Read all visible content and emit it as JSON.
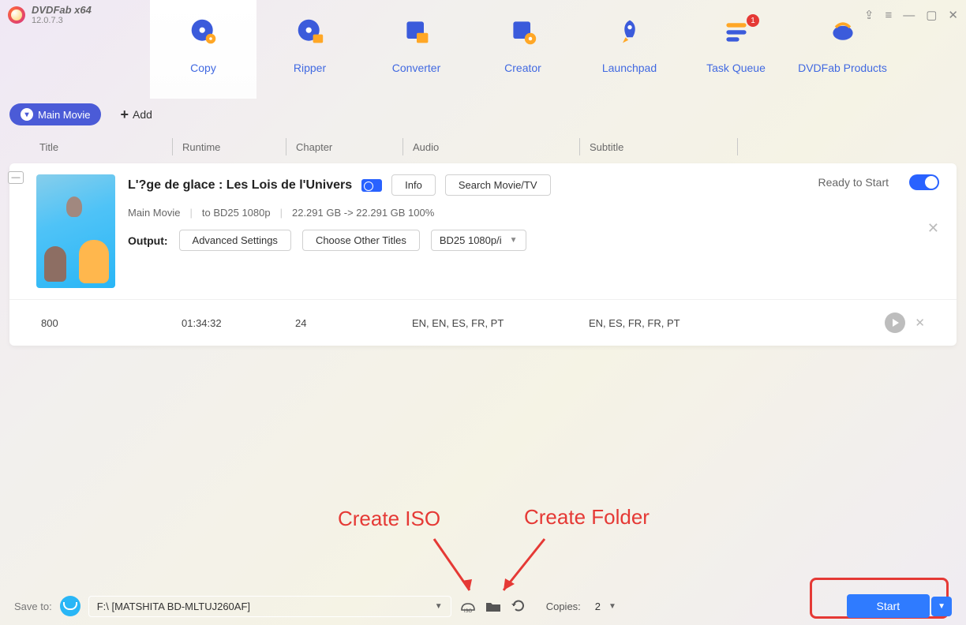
{
  "app": {
    "name": "DVDFab x64",
    "version": "12.0.7.3"
  },
  "tabs": [
    {
      "label": "Copy",
      "active": true
    },
    {
      "label": "Ripper"
    },
    {
      "label": "Converter"
    },
    {
      "label": "Creator"
    },
    {
      "label": "Launchpad"
    },
    {
      "label": "Task Queue",
      "badge": "1"
    },
    {
      "label": "DVDFab Products"
    }
  ],
  "mode": {
    "pill": "Main Movie",
    "add": "Add"
  },
  "columns": {
    "title": "Title",
    "runtime": "Runtime",
    "chapter": "Chapter",
    "audio": "Audio",
    "subtitle": "Subtitle"
  },
  "movie": {
    "title": "L'?ge de glace : Les Lois de l'Univers",
    "info_btn": "Info",
    "search_btn": "Search Movie/TV",
    "status": "Ready to Start",
    "meta": {
      "mode": "Main Movie",
      "target": "to BD25 1080p",
      "size": "22.291 GB -> 22.291 GB 100%"
    },
    "output_label": "Output:",
    "adv": "Advanced Settings",
    "other": "Choose Other Titles",
    "profile": "BD25 1080p/i"
  },
  "row": {
    "title": "800",
    "runtime": "01:34:32",
    "chapter": "24",
    "audio": "EN, EN, ES, FR, PT",
    "subtitle": "EN, ES, FR, FR, PT"
  },
  "anno": {
    "iso": "Create ISO",
    "folder": "Create Folder"
  },
  "bottom": {
    "saveto": "Save to:",
    "path": "F:\\ [MATSHITA BD-MLTUJ260AF]",
    "copies": "Copies:",
    "copies_val": "2",
    "start": "Start"
  }
}
